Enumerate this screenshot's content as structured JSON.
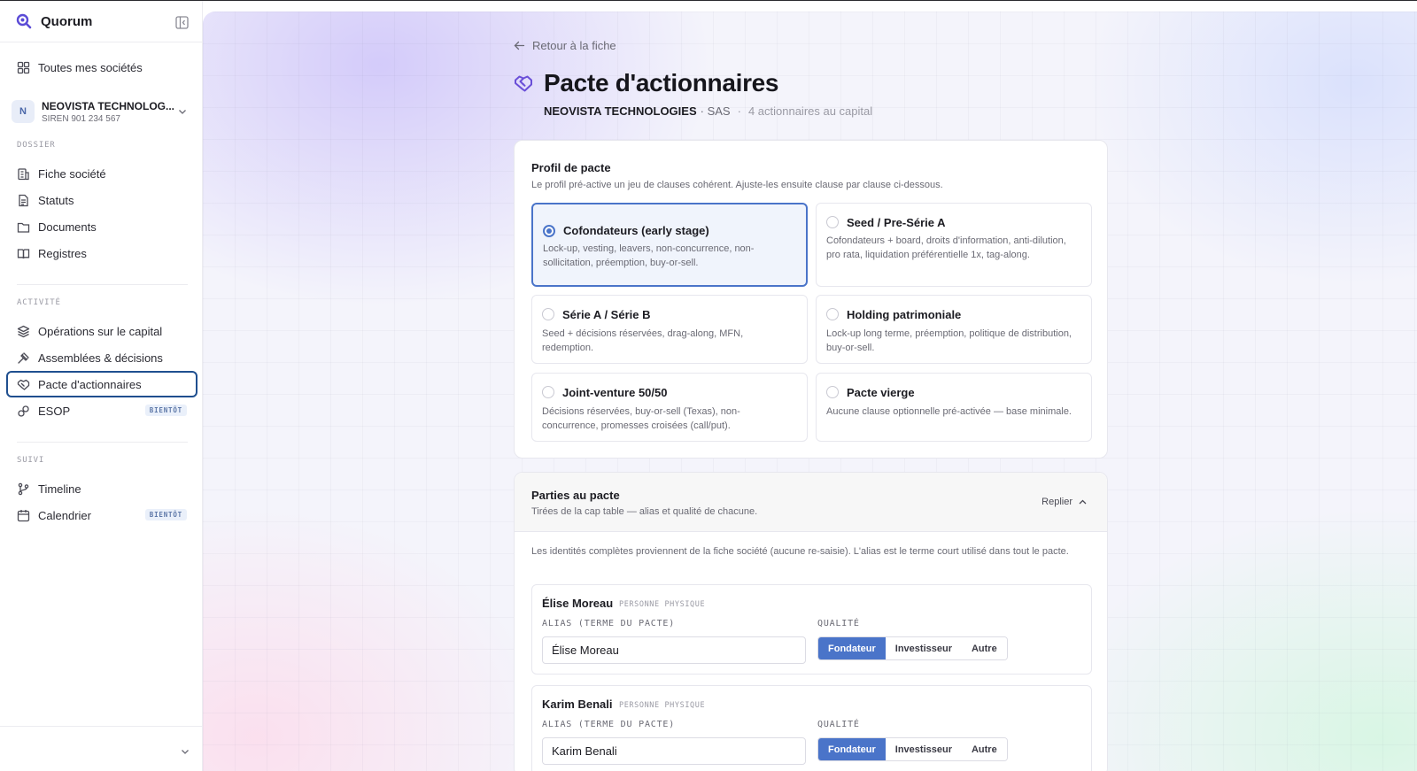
{
  "app": {
    "name": "Quorum"
  },
  "sidebar": {
    "all_companies": "Toutes mes sociétés",
    "company": {
      "initial": "N",
      "name": "NEOVISTA TECHNOLOG...",
      "siren": "SIREN 901 234 567"
    },
    "sections": {
      "dossier": "DOSSIER",
      "activite": "ACTIVITÉ",
      "suivi": "SUIVI"
    },
    "items": {
      "fiche": "Fiche société",
      "statuts": "Statuts",
      "documents": "Documents",
      "registres": "Registres",
      "operations": "Opérations sur le capital",
      "assemblees": "Assemblées & décisions",
      "pacte": "Pacte d'actionnaires",
      "esop": "ESOP",
      "timeline": "Timeline",
      "calendrier": "Calendrier"
    },
    "badge_soon": "BIENTÔT"
  },
  "header": {
    "back": "Retour à la fiche",
    "title": "Pacte d'actionnaires",
    "company": "NEOVISTA TECHNOLOGIES",
    "form": "· SAS",
    "sep": "·",
    "shareholders": "4 actionnaires au capital"
  },
  "profile": {
    "title": "Profil de pacte",
    "desc": "Le profil pré-active un jeu de clauses cohérent. Ajuste-les ensuite clause par clause ci-dessous.",
    "selected": "Cofondateurs (early stage)",
    "options": [
      {
        "title": "Cofondateurs (early stage)",
        "desc": "Lock-up, vesting, leavers, non-concurrence, non-sollicitation, préemption, buy-or-sell."
      },
      {
        "title": "Seed / Pre-Série A",
        "desc": "Cofondateurs + board, droits d'information, anti-dilution, pro rata, liquidation préférentielle 1x, tag-along."
      },
      {
        "title": "Série A / Série B",
        "desc": "Seed + décisions réservées, drag-along, MFN, redemption."
      },
      {
        "title": "Holding patrimoniale",
        "desc": "Lock-up long terme, préemption, politique de distribution, buy-or-sell."
      },
      {
        "title": "Joint-venture 50/50",
        "desc": "Décisions réservées, buy-or-sell (Texas), non-concurrence, promesses croisées (call/put)."
      },
      {
        "title": "Pacte vierge",
        "desc": "Aucune clause optionnelle pré-activée — base minimale."
      }
    ]
  },
  "parties": {
    "title": "Parties au pacte",
    "desc": "Tirées de la cap table — alias et qualité de chacune.",
    "collapse": "Replier",
    "info": "Les identités complètes proviennent de la fiche société (aucune re-saisie). L'alias est le terme court utilisé dans tout le pacte.",
    "alias_label": "ALIAS (TERME DU PACTE)",
    "quality_label": "QUALITÉ",
    "quality_options": [
      "Fondateur",
      "Investisseur",
      "Autre"
    ],
    "list": [
      {
        "name": "Élise Moreau",
        "type": "PERSONNE PHYSIQUE",
        "alias": "Élise Moreau",
        "quality": "Fondateur"
      },
      {
        "name": "Karim Benali",
        "type": "PERSONNE PHYSIQUE",
        "alias": "Karim Benali",
        "quality": "Fondateur"
      }
    ]
  },
  "colors": {
    "accent": "#4a74c9",
    "active_border": "#1f4f8f",
    "brand": "#5b4bd6"
  }
}
